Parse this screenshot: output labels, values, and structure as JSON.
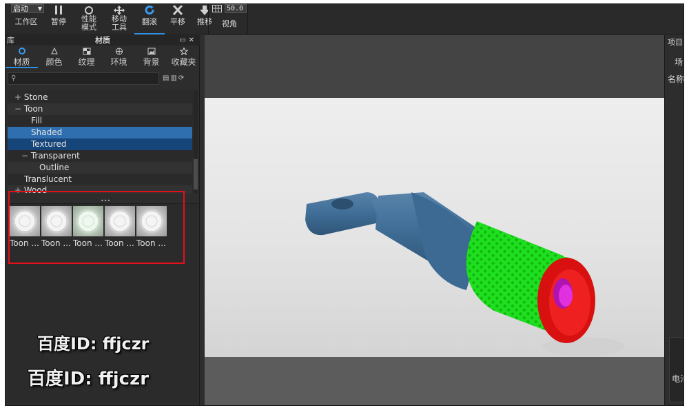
{
  "toolbar": {
    "workspace_value": "启动",
    "workspace_label": "工作区",
    "pause_label": "暂停",
    "performance_label": "性能\n模式",
    "move_tool_label": "移动\n工具",
    "tumble_label": "翻滚",
    "pan_label": "平移",
    "dolly_label": "推移",
    "fov_value": "50.0",
    "view_label": "视角"
  },
  "library_panel": {
    "title": "库",
    "subtitle": "材质",
    "tabs": [
      {
        "label": "材质",
        "icon": "material-icon",
        "active": true
      },
      {
        "label": "颜色",
        "icon": "color-icon",
        "active": false
      },
      {
        "label": "纹理",
        "icon": "texture-icon",
        "active": false
      },
      {
        "label": "环境",
        "icon": "environment-icon",
        "active": false
      },
      {
        "label": "背景",
        "icon": "background-icon",
        "active": false
      },
      {
        "label": "收藏夹",
        "icon": "favorites-icon",
        "active": false
      }
    ],
    "search_placeholder": "",
    "tree": [
      {
        "label": "Stone",
        "toggle": "+"
      },
      {
        "label": "Toon",
        "toggle": "−"
      },
      {
        "label": "Fill",
        "toggle": ""
      },
      {
        "label": "Shaded",
        "toggle": "",
        "state": "selected"
      },
      {
        "label": "Textured",
        "toggle": "",
        "state": "selected-dark"
      },
      {
        "label": "Transparent",
        "toggle": "−"
      },
      {
        "label": "Outline",
        "toggle": ""
      },
      {
        "label": "Translucent",
        "toggle": ""
      },
      {
        "label": "Wood",
        "toggle": "+"
      }
    ],
    "thumbnails": [
      {
        "label": "Toon ..."
      },
      {
        "label": "Toon ..."
      },
      {
        "label": "Toon ..."
      },
      {
        "label": "Toon ..."
      },
      {
        "label": "Toon ..."
      }
    ]
  },
  "watermark": {
    "line1": "百度ID: ffjczr",
    "line2": "百度ID: ffjczr"
  },
  "right_panel": {
    "title": "项目",
    "item1": "场",
    "name_label": "名称",
    "item2": "电池"
  },
  "colors": {
    "accent": "#2f8fe0",
    "selection": "#2f6fb0",
    "selection_dark": "#16457a",
    "highlight_box": "#e3101a",
    "model_body": "#3f6d95",
    "model_grip": "#1fe01f",
    "model_rim": "#e11010",
    "model_core": "#e020e0"
  }
}
